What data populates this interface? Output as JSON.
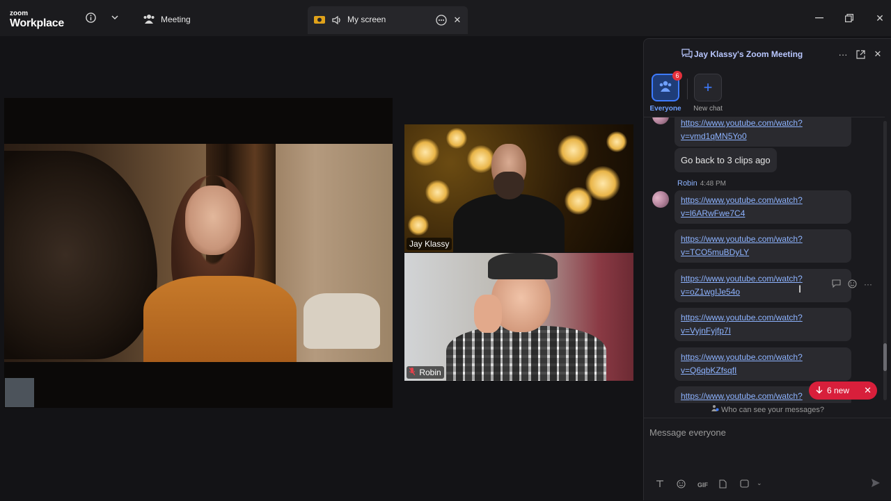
{
  "titlebar": {
    "logo_line1": "zoom",
    "logo_line2": "Workplace",
    "meeting_label": "Meeting",
    "my_screen_label": "My screen"
  },
  "videos": {
    "main": {
      "name": ""
    },
    "tiles": [
      {
        "name": "Jay Klassy"
      },
      {
        "name": "Robin",
        "muted": true
      }
    ]
  },
  "chat": {
    "title": "Jay Klassy's Zoom Meeting",
    "channels": [
      {
        "label": "Everyone",
        "badge": "6",
        "icon": "people-icon"
      },
      {
        "label": "New chat",
        "icon": "plus-icon"
      }
    ],
    "messages": [
      {
        "link_line1": "https://www.youtube.com/watch?",
        "link_line2": "v=vmd1qMN5Yo0"
      },
      {
        "text": "Go back to 3 clips ago"
      },
      {
        "sender": "Robin",
        "time": "4:48 PM"
      },
      {
        "link_line1": "https://www.youtube.com/watch?",
        "link_line2": "v=l6ARwFwe7C4"
      },
      {
        "link_line1": "https://www.youtube.com/watch?",
        "link_line2": "v=TCO5muBDyLY"
      },
      {
        "link_line1": "https://www.youtube.com/watch?",
        "link_line2": "v=oZ1wgIJe54o"
      },
      {
        "link_line1": "https://www.youtube.com/watch?",
        "link_line2": "v=VyjnFyjfp7I"
      },
      {
        "link_line1": "https://www.youtube.com/watch?",
        "link_line2": "v=Q6qbKZfsqfI"
      },
      {
        "link_line1": "https://www.youtube.com/watch?"
      }
    ],
    "new_messages_label": "6 new",
    "who_can_see": "Who can see your messages?",
    "composer_placeholder": "Message everyone",
    "toolbar": {
      "gif_label": "GIF"
    }
  },
  "colors": {
    "accent": "#3e7bff",
    "link": "#8db3ff",
    "alert": "#d81f3b"
  }
}
